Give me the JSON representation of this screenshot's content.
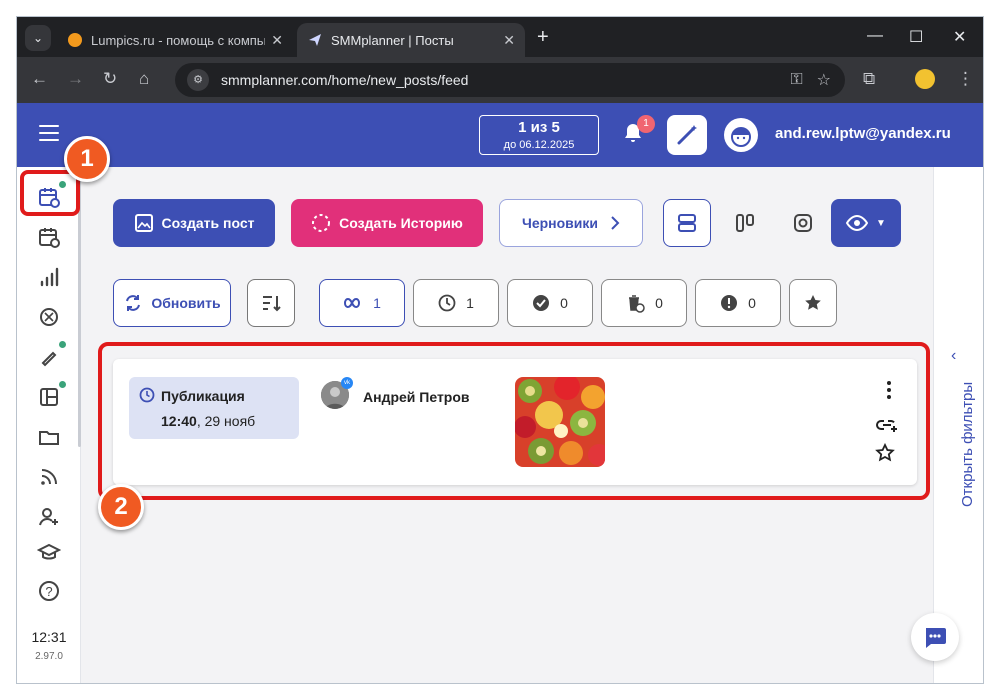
{
  "browser": {
    "tabs": [
      {
        "title": "Lumpics.ru - помощь с компью",
        "active": false
      },
      {
        "title": "SMMplanner | Посты",
        "active": true
      }
    ],
    "url": "smmplanner.com/home/new_posts/feed"
  },
  "header": {
    "counter_main": "1 из 5",
    "counter_sub": "до 06.12.2025",
    "notifications_count": "1",
    "user_email": "and.rew.lptw@yandex.ru"
  },
  "toolbar": {
    "create_post": "Создать пост",
    "create_story": "Создать Историю",
    "drafts": "Черновики",
    "refresh": "Обновить"
  },
  "filters": [
    {
      "icon": "infinity-icon",
      "count": "1"
    },
    {
      "icon": "clock-icon",
      "count": "1"
    },
    {
      "icon": "check-circle-icon",
      "count": "0"
    },
    {
      "icon": "trash-clock-icon",
      "count": "0"
    },
    {
      "icon": "error-icon",
      "count": "0"
    },
    {
      "icon": "star-icon",
      "count": ""
    }
  ],
  "post": {
    "status": "Публикация",
    "time": "12:40",
    "date": ", 29 нояб",
    "author": "Андрей Петров",
    "network_badge": "vk"
  },
  "sidebar": {
    "time": "12:31",
    "version": "2.97.0"
  },
  "right_panel": {
    "open_filters": "Открыть фильтры"
  },
  "annotations": {
    "step1": "1",
    "step2": "2"
  },
  "colors": {
    "brand": "#3d4fb4",
    "story": "#e1307a",
    "highlight": "#e01b1b",
    "step_badge": "#f05a22"
  }
}
